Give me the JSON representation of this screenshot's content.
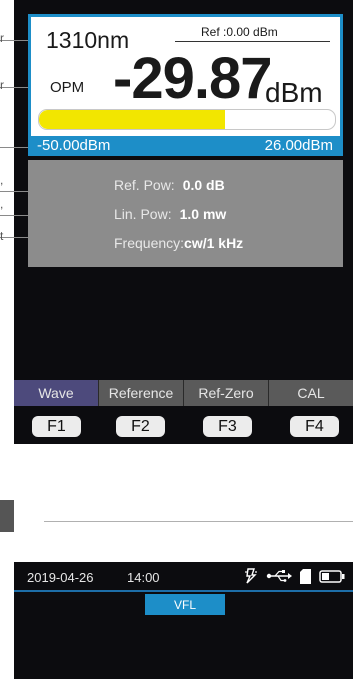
{
  "callout_tags": [
    "r",
    "r",
    ",",
    ",",
    "t"
  ],
  "meter": {
    "wavelength": "1310nm",
    "ref": "Ref :0.00 dBm",
    "mode": "OPM",
    "power_value": "-29.87",
    "power_unit": "dBm",
    "level_fraction": 0.63
  },
  "range": {
    "min": "-50.00dBm",
    "max": "26.00dBm"
  },
  "info": {
    "ref_pow_label": "Ref. Pow:",
    "ref_pow_value": "0.0 dB",
    "lin_pow_label": "Lin. Pow:",
    "lin_pow_value": "1.0 mw",
    "freq_label": "Frequency:",
    "freq_value": "cw/1 kHz"
  },
  "softkeys": [
    "Wave",
    "Reference",
    "Ref-Zero",
    "CAL"
  ],
  "fkeys": [
    "F1",
    "F2",
    "F3",
    "F4"
  ],
  "status": {
    "date": "2019-04-26",
    "time": "14:00",
    "icons": [
      "light-icon",
      "usb-icon",
      "sd-card-icon",
      "battery-icon"
    ]
  },
  "vfl_tab": "VFL",
  "colors": {
    "accent": "#1d8ec8",
    "bar_fill": "#f2e600",
    "active_softkey": "#4d4a7c"
  }
}
